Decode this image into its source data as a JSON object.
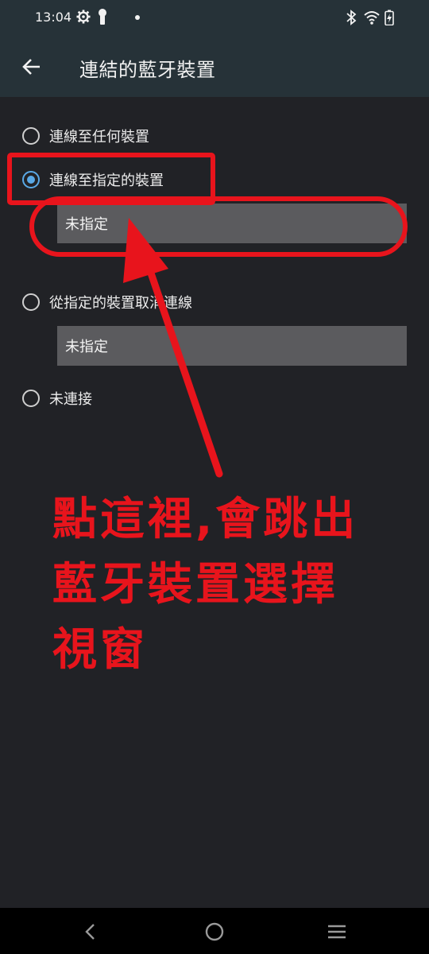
{
  "status_bar": {
    "time": "13:04",
    "icons": [
      "settings-icon",
      "key-icon",
      "notification-dot",
      "bluetooth-icon",
      "wifi-icon",
      "battery-charging-icon"
    ]
  },
  "app_bar": {
    "title": "連結的藍牙裝置",
    "back_icon": "arrow-back-icon"
  },
  "options": [
    {
      "label": "連線至任何裝置",
      "selected": false
    },
    {
      "label": "連線至指定的裝置",
      "selected": true,
      "device_value": "未指定"
    },
    {
      "label": "從指定的裝置取消連線",
      "selected": false,
      "device_value": "未指定"
    },
    {
      "label": "未連接",
      "selected": false
    }
  ],
  "annotation": {
    "lines": [
      "點這裡,會跳出",
      "藍牙裝置選擇",
      "視窗"
    ],
    "color": "#e8141c"
  },
  "nav_bar": {
    "icons": [
      "back-nav-icon",
      "home-nav-icon",
      "recents-nav-icon"
    ]
  },
  "colors": {
    "background": "#212226",
    "app_bar": "#263238",
    "accent": "#5aa9e6",
    "field": "#5b5b5e"
  }
}
